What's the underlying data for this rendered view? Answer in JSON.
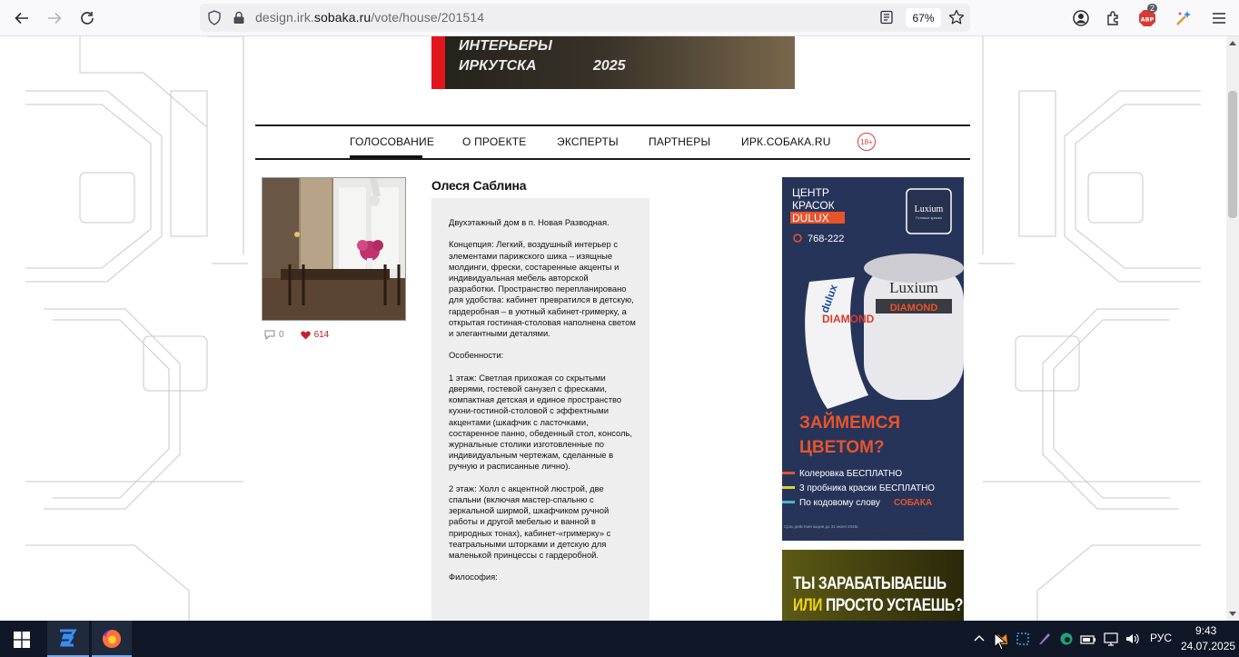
{
  "browser": {
    "url_prefix": "design.irk.",
    "url_domain": "sobaka.ru",
    "url_path": "/vote/house/201514",
    "zoom": "67%",
    "extension_badge": "2",
    "abp_label": "ABP"
  },
  "banner": {
    "line1": "ИНТЕРЬЕРЫ",
    "line2": "ИРКУТСКА",
    "year": "2025"
  },
  "nav": {
    "items": [
      "ГОЛОСОВАНИЕ",
      "О ПРОЕКТЕ",
      "ЭКСПЕРТЫ",
      "ПАРТНЕРЫ",
      "ИРК.СОБАКА.RU"
    ],
    "age_label": "18+"
  },
  "entry": {
    "comments": "0",
    "likes": "614",
    "author": "Олеся Саблина",
    "paragraphs": [
      "Двухэтажный дом в п. Новая Разводная.",
      "Концепция: Легкий, воздушный интерьер с элементами парижского шика – изящные молдинги, фрески, состаренные акценты и индивидуальная мебель авторской разработки. Пространство перепланировано для удобства: кабинет превратился в детскую, гардеробная – в уютный кабинет-гримерку, а открытая гостиная-столовая наполнена светом и элегантными деталями.",
      "Особенности:",
      "1 этаж: Светлая прихожая со скрытыми дверями, гостевой санузел с фресками, компактная детская и единое пространство кухни-гостиной-столовой с эффектными акцентами (шкафчик с ласточками, состаренное панно, обеденный стол, консоль, журнальные столики изготовленные по индивидуальным чертежам, сделанные в ручную и расписанные лично).",
      "2 этаж: Холл с акцентной люстрой, две спальни (включая мастер-спальню с зеркальной ширмой, шкафчиком ручной работы и другой мебелью и ванной в природных тонах), кабинет-«гримерку» с театральными шторками и детскую для маленькой принцессы с гардеробной.",
      "Философия:"
    ]
  },
  "ad1": {
    "brand_line1": "ЦЕНТР",
    "brand_line2": "КРАСОК",
    "brand_line3": "DULUX",
    "phone": "768-222",
    "logo_text": "Luxium",
    "logo_sub": "Готовые краски",
    "can_brand": "Luxium",
    "can_product": "DIAMOND",
    "can_side_brand": "dulux",
    "can_side_product": "DIAMOND",
    "headline_line1": "ЗАЙМЕМСЯ",
    "headline_line2": "ЦВЕТОМ?",
    "bullets": [
      {
        "text": "Колеровка БЕСПЛАТНО",
        "color": "#e8542a"
      },
      {
        "text": "3 пробника краски БЕСПЛАТНО",
        "color": "#d8d23a"
      },
      {
        "text": "По кодовому слову",
        "color": "#4ab6c9",
        "keyword": "СОБАКА"
      }
    ],
    "fineprint": "Срок действия акции до 31 июля 2025г.",
    "caption": "РЕКЛАМА ИП Садовская Ю.А. ИНН 382105347186 ERID:2VfnxyWsmc"
  },
  "ad2": {
    "line1": "ТЫ ЗАРАБАТЫВАЕШЬ",
    "line2_yellow": "ИЛИ",
    "line2_rest": "ПРОСТО УСТАЕШЬ?"
  },
  "taskbar": {
    "language": "РУС",
    "time": "9:43",
    "date": "24.07.2025"
  }
}
